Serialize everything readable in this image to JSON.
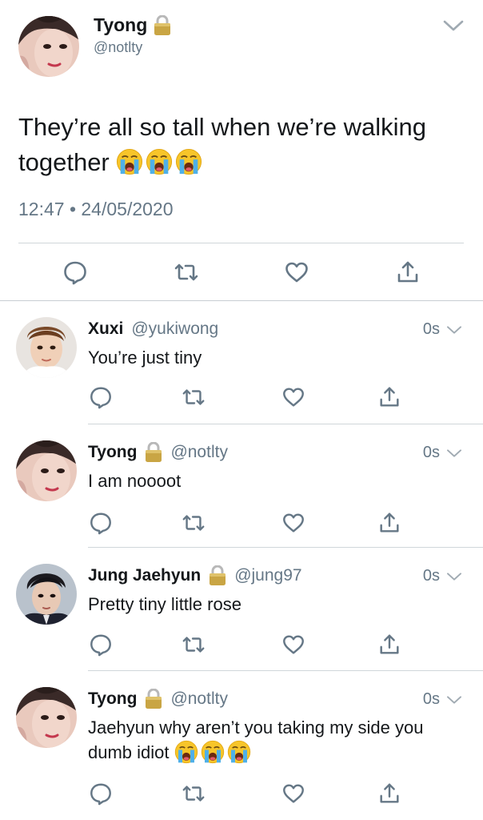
{
  "main_tweet": {
    "display_name": "Tyong",
    "handle": "@notlty",
    "text": "They’re all so tall when we’re walking together",
    "timestamp": "12:47 • 24/05/2020",
    "emoji_count": 3,
    "icons": [
      "reply-icon",
      "retweet-icon",
      "like-icon",
      "share-icon"
    ]
  },
  "replies": [
    {
      "display_name": "Xuxi",
      "handle": "@yukiwong",
      "time": "0s",
      "text": "You’re just tiny",
      "protected": false
    },
    {
      "display_name": "Tyong",
      "handle": "@notlty",
      "time": "0s",
      "text": "I am noooot",
      "protected": true
    },
    {
      "display_name": "Jung Jaehyun",
      "handle": "@jung97",
      "time": "0s",
      "text": "Pretty tiny little rose",
      "protected": true
    },
    {
      "display_name": "Tyong",
      "handle": "@notlty",
      "time": "0s",
      "text": "Jaehyun why aren’t you taking my side you dumb idiot",
      "protected": true
    }
  ],
  "colors": {
    "text": "#14171a",
    "secondary": "#657786",
    "icon": "#657786",
    "separator": "#d0d6da"
  }
}
